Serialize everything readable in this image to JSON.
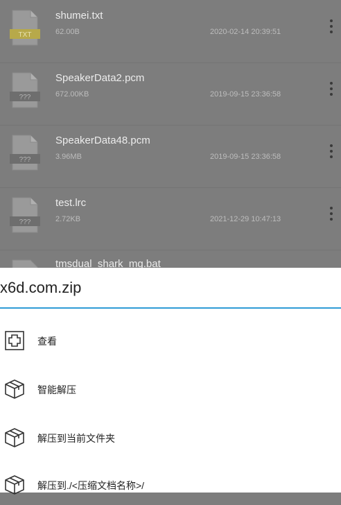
{
  "files": [
    {
      "name": "shumei.txt",
      "size": "62.00B",
      "date": "2020-02-14 20:39:51",
      "icon": "txt-file-icon",
      "icon_label": "TXT",
      "icon_color": "#b7a94a"
    },
    {
      "name": "SpeakerData2.pcm",
      "size": "672.00KB",
      "date": "2019-09-15 23:36:58",
      "icon": "unknown-file-icon",
      "icon_label": "???",
      "icon_color": "#6e6e6e"
    },
    {
      "name": "SpeakerData48.pcm",
      "size": "3.96MB",
      "date": "2019-09-15 23:36:58",
      "icon": "unknown-file-icon",
      "icon_label": "???",
      "icon_color": "#6e6e6e"
    },
    {
      "name": "test.lrc",
      "size": "2.72KB",
      "date": "2021-12-29 10:47:13",
      "icon": "unknown-file-icon",
      "icon_label": "???",
      "icon_color": "#6e6e6e"
    },
    {
      "name": "tmsdual_shark_mg.bat",
      "size": "",
      "date": "",
      "icon": "file-icon",
      "icon_label": "",
      "icon_color": "#6e6e6e"
    }
  ],
  "sheet": {
    "title": "x6d.com.zip",
    "accent_color": "#2f9bd6",
    "actions": [
      {
        "label": "查看",
        "icon": "plus-box-icon"
      },
      {
        "label": "智能解压",
        "icon": "package-icon"
      },
      {
        "label": "解压到当前文件夹",
        "icon": "package-icon"
      },
      {
        "label": "解压到./<压缩文档名称>/",
        "icon": "package-icon"
      }
    ]
  }
}
